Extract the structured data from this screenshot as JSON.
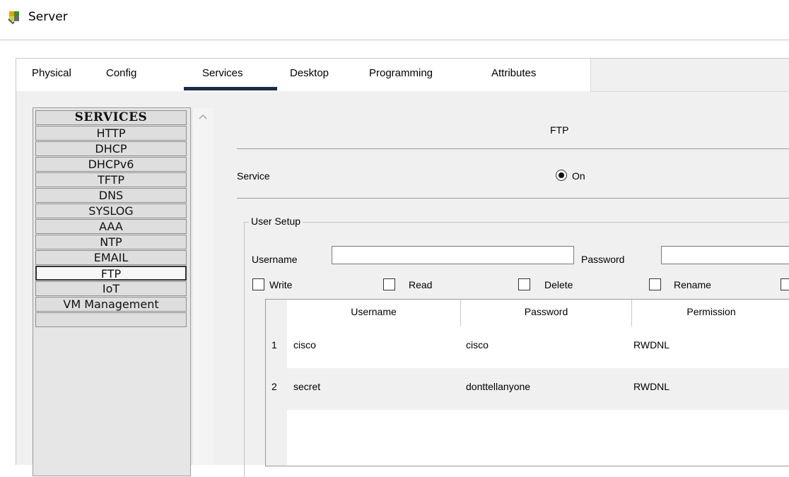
{
  "window": {
    "title": "Server",
    "icon": "server-app-icon"
  },
  "tabs": [
    {
      "label": "Physical",
      "active": false
    },
    {
      "label": "Config",
      "active": false
    },
    {
      "label": "Services",
      "active": true
    },
    {
      "label": "Desktop",
      "active": false
    },
    {
      "label": "Programming",
      "active": false
    },
    {
      "label": "Attributes",
      "active": false
    }
  ],
  "services": {
    "header": "SERVICES",
    "items": [
      "HTTP",
      "DHCP",
      "DHCPv6",
      "TFTP",
      "DNS",
      "SYSLOG",
      "AAA",
      "NTP",
      "EMAIL",
      "FTP",
      "IoT",
      "VM Management"
    ],
    "selected": "FTP"
  },
  "ftp": {
    "title": "FTP",
    "service_label": "Service",
    "service_state": "On",
    "user_setup": {
      "legend": "User Setup",
      "username_label": "Username",
      "username_value": "",
      "password_label": "Password",
      "password_value": "",
      "permissions": [
        "Write",
        "Read",
        "Delete",
        "Rename"
      ]
    },
    "table": {
      "columns": [
        "Username",
        "Password",
        "Permission"
      ],
      "rows": [
        {
          "num": "1",
          "username": "cisco",
          "password": "cisco",
          "permission": "RWDNL"
        },
        {
          "num": "2",
          "username": "secret",
          "password": "donttellanyone",
          "permission": "RWDNL"
        }
      ]
    }
  }
}
